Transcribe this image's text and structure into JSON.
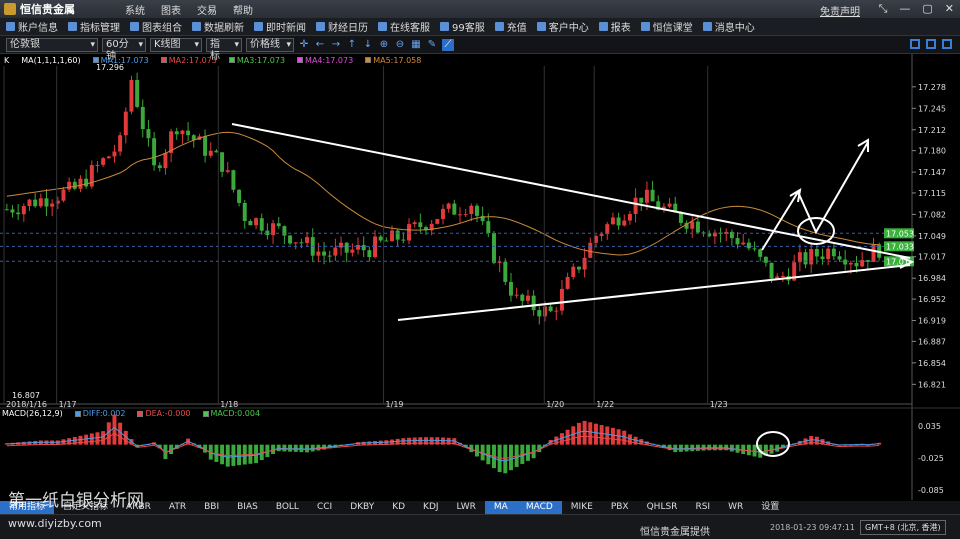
{
  "window": {
    "title": "恒信贵金属",
    "menu": [
      "系统",
      "图表",
      "交易",
      "帮助"
    ],
    "disclaimer": "免责声明"
  },
  "toolbar": [
    {
      "label": "账户信息",
      "icon": "user-icon"
    },
    {
      "label": "指标管理",
      "icon": "indicator-icon"
    },
    {
      "label": "图表组合",
      "icon": "layout-icon"
    },
    {
      "label": "数据刷新",
      "icon": "refresh-icon"
    },
    {
      "label": "即时新闻",
      "icon": "news-icon"
    },
    {
      "label": "财经日历",
      "icon": "calendar-icon"
    },
    {
      "label": "在线客服",
      "icon": "chat-icon"
    },
    {
      "label": "99客服",
      "icon": "support-icon"
    },
    {
      "label": "充值",
      "icon": "deposit-icon"
    },
    {
      "label": "客户中心",
      "icon": "client-icon"
    },
    {
      "label": "报表",
      "icon": "report-icon"
    },
    {
      "label": "恒信课堂",
      "icon": "school-icon"
    },
    {
      "label": "消息中心",
      "icon": "message-icon"
    }
  ],
  "chart_toolbar": {
    "symbol": "伦敦银",
    "period": "60分钟",
    "chart_type": "K线图",
    "indicator": "指标",
    "price_line": "价格线"
  },
  "ma_legend": {
    "prefix": "K",
    "series_label": "MA(1,1,1,1,60)",
    "items": [
      {
        "label": "MA1:17.073",
        "color": "#4a9de8"
      },
      {
        "label": "MA2:17.073",
        "color": "#e84a4a"
      },
      {
        "label": "MA3:17.073",
        "color": "#4ac94a"
      },
      {
        "label": "MA4:17.073",
        "color": "#e84ae8"
      },
      {
        "label": "MA5:17.058",
        "color": "#d48a3a"
      }
    ]
  },
  "macd_legend": {
    "label": "MACD(26,12,9)",
    "items": [
      {
        "label": "DIFF:0.002",
        "color": "#4a9de8"
      },
      {
        "label": "DEA:-0.000",
        "color": "#e84a4a"
      },
      {
        "label": "MACD:0.004",
        "color": "#4ac94a"
      }
    ]
  },
  "chart_data": {
    "type": "candlestick",
    "price_axis": {
      "ticks": [
        "17.278",
        "17.245",
        "17.212",
        "17.180",
        "17.147",
        "17.115",
        "17.082",
        "17.049",
        "17.017",
        "16.984",
        "16.952",
        "16.919",
        "16.887",
        "16.854",
        "16.821"
      ],
      "ylim": [
        16.8,
        17.31
      ]
    },
    "price_tags": [
      {
        "label": "17.053",
        "value": 17.053,
        "color": "#38b23a"
      },
      {
        "label": "17.033",
        "value": 17.033,
        "color": "#38b23a"
      },
      {
        "label": "17.01",
        "value": 17.01,
        "color": "#38b23a"
      }
    ],
    "high_label": "17.296",
    "low_label": "16.807",
    "date_labels": [
      {
        "label": "2018/1/16",
        "pos": 0.0
      },
      {
        "label": "1/17",
        "pos": 0.058
      },
      {
        "label": "1/18",
        "pos": 0.236
      },
      {
        "label": "1/19",
        "pos": 0.418
      },
      {
        "label": "1/20",
        "pos": 0.595
      },
      {
        "label": "1/22",
        "pos": 0.65
      },
      {
        "label": "1/23",
        "pos": 0.775
      }
    ],
    "macd_axis": {
      "ticks": [
        "0.035",
        "-0.025",
        "-0.085"
      ],
      "ylim": [
        -0.1,
        0.05
      ]
    }
  },
  "indicator_tabs": [
    "常用指标",
    "自定义指标",
    "ARBR",
    "ATR",
    "BBI",
    "BIAS",
    "BOLL",
    "CCI",
    "DKBY",
    "KD",
    "KDJ",
    "LWR",
    "MA",
    "MACD",
    "MIKE",
    "PBX",
    "QHLSR",
    "RSI",
    "WR",
    "设置"
  ],
  "active_tabs": [
    "常用指标",
    "MA",
    "MACD"
  ],
  "status": {
    "provider": "恒信贵金属提供",
    "datetime": "2018-01-23 09:47:11",
    "timezone": "GMT+8 (北京, 香港)"
  },
  "watermark": {
    "line1": "第一纸白银分析网",
    "line2": "www.diyizby.com"
  }
}
